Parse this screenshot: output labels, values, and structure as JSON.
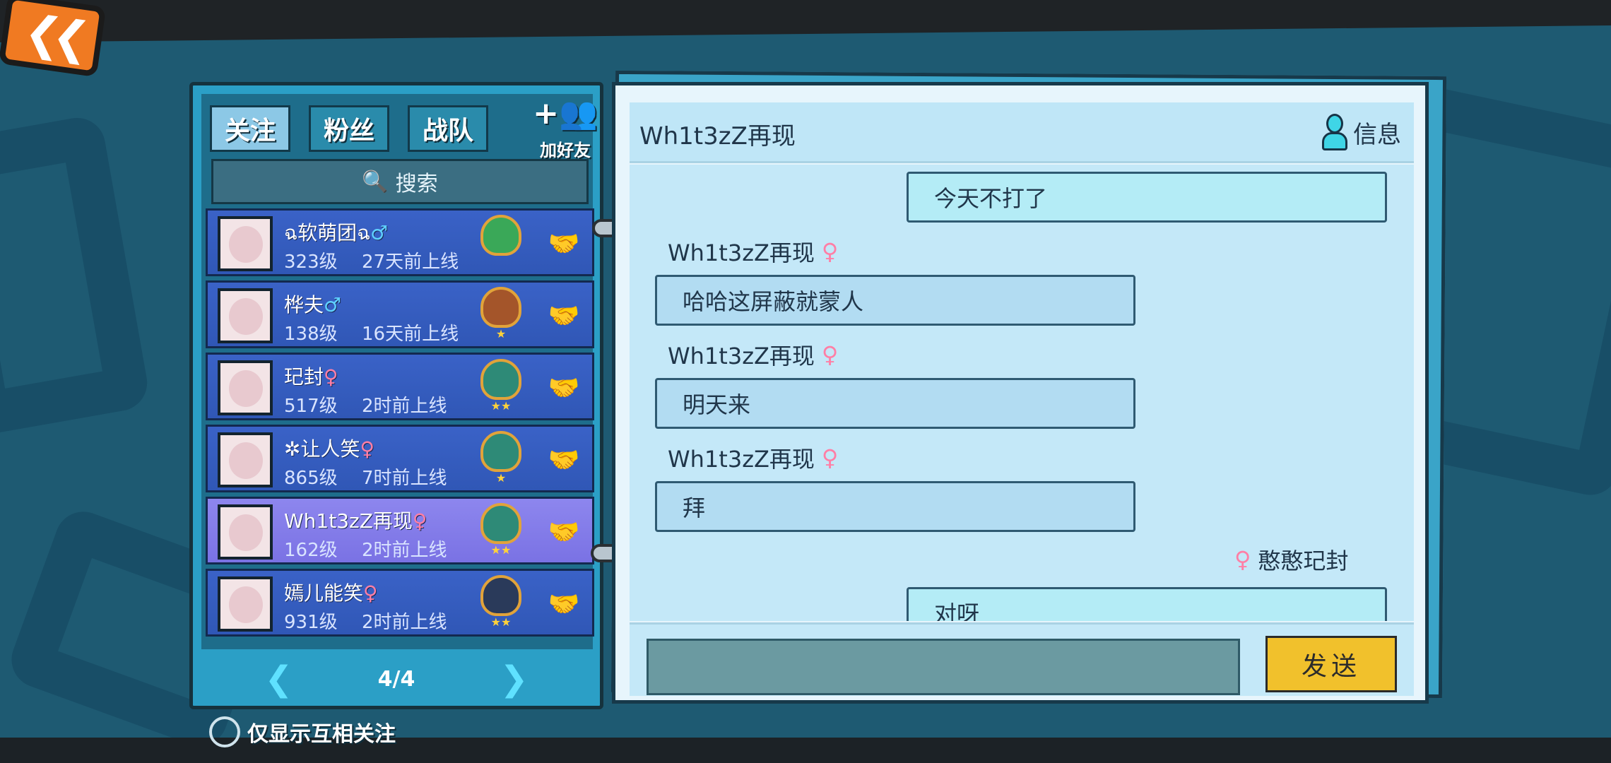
{
  "nav": {
    "back_icon": "double-chevron-left-icon"
  },
  "tabs": [
    {
      "label": "关注",
      "active": true
    },
    {
      "label": "粉丝",
      "active": false
    },
    {
      "label": "战队",
      "active": false
    }
  ],
  "add_friend": {
    "label": "加好友",
    "icon": "add-person-icon"
  },
  "search": {
    "label": "搜索",
    "icon": "search-icon"
  },
  "friends": [
    {
      "name": "ฉ软萌团ฉ",
      "gender": "♂",
      "level": "323级",
      "status": "27天前上线",
      "badge_color": "#3aa858",
      "stars": "",
      "active": false
    },
    {
      "name": "桦夫",
      "gender": "♂",
      "level": "138级",
      "status": "16天前上线",
      "badge_color": "#a4552a",
      "stars": "★",
      "active": false
    },
    {
      "name": "玘封",
      "gender": "♀",
      "level": "517级",
      "status": "2时前上线",
      "badge_color": "#2e8a77",
      "stars": "★★",
      "active": false
    },
    {
      "name": "✲让人笑",
      "gender": "♀",
      "level": "865级",
      "status": "7时前上线",
      "badge_color": "#2e8a77",
      "stars": "★",
      "active": false
    },
    {
      "name": "Wh1t3zZ再现",
      "gender": "♀",
      "level": "162级",
      "status": "2时前上线",
      "badge_color": "#2e8a77",
      "stars": "★★",
      "active": true
    },
    {
      "name": "嫣儿能笑",
      "gender": "♀",
      "level": "931级",
      "status": "2时前上线",
      "badge_color": "#2a3a5a",
      "stars": "★★",
      "active": false
    }
  ],
  "pager": {
    "prev_icon": "chevron-left-icon",
    "next_icon": "chevron-right-icon",
    "text": "4/4"
  },
  "mutual_filter": {
    "label": "仅显示互相关注",
    "checked": false
  },
  "chat": {
    "title": "Wh1t3zZ再现",
    "info_label": "信息",
    "messages": [
      {
        "from": "me",
        "text": "今天不打了"
      },
      {
        "from": "them",
        "sender": "Wh1t3zZ再现",
        "gender": "♀",
        "text": "哈哈这屏蔽就蒙人"
      },
      {
        "from": "them",
        "sender": "Wh1t3zZ再现",
        "gender": "♀",
        "text": "明天来"
      },
      {
        "from": "them",
        "sender": "Wh1t3zZ再现",
        "gender": "♀",
        "text": "拜"
      },
      {
        "from": "me",
        "sender": "憨憨玘封",
        "gender": "♀",
        "text": "对呀"
      }
    ],
    "input_value": "",
    "send_label": "发送"
  }
}
